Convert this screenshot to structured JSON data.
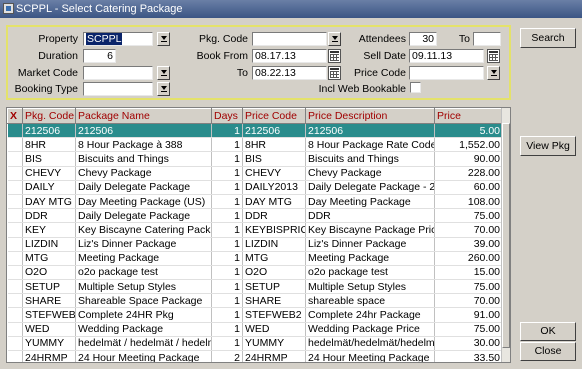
{
  "window": {
    "title": "SCPPL - Select Catering Package"
  },
  "filters": {
    "property_label": "Property",
    "property_value": "SCPPL",
    "duration_label": "Duration",
    "duration_value": "6",
    "market_code_label": "Market Code",
    "market_code_value": "",
    "booking_type_label": "Booking Type",
    "booking_type_value": "",
    "pkg_code_label": "Pkg. Code",
    "pkg_code_value": "",
    "book_from_label": "Book From",
    "book_from_value": "08.17.13",
    "to_label": "To",
    "book_to_value": "08.22.13",
    "attendees_label": "Attendees",
    "attendees_value": "30",
    "attendees_to_label": "To",
    "attendees_to_value": "",
    "sell_date_label": "Sell Date",
    "sell_date_value": "09.11.13",
    "price_code_label": "Price Code",
    "price_code_value": "",
    "incl_web_label": "Incl Web Bookable"
  },
  "buttons": {
    "search": "Search",
    "view_pkg": "View Pkg",
    "ok": "OK",
    "close": "Close"
  },
  "table": {
    "headers": {
      "x": "X",
      "pkg_code": "Pkg. Code",
      "package_name": "Package Name",
      "days": "Days",
      "price_code": "Price Code",
      "price_description": "Price Description",
      "price": "Price"
    },
    "rows": [
      {
        "code": "212506",
        "name": "212506",
        "days": "1",
        "pcode": "212506",
        "pdesc": "212506",
        "price": "5.00"
      },
      {
        "code": "8HR",
        "name": "8 Hour Package à 388",
        "days": "1",
        "pcode": "8HR",
        "pdesc": "8 Hour Package Rate Code",
        "price": "1,552.00"
      },
      {
        "code": "BIS",
        "name": "Biscuits and Things",
        "days": "1",
        "pcode": "BIS",
        "pdesc": "Biscuits and Things",
        "price": "90.00"
      },
      {
        "code": "CHEVY",
        "name": "Chevy Package",
        "days": "1",
        "pcode": "CHEVY",
        "pdesc": "Chevy Package",
        "price": "228.00"
      },
      {
        "code": "DAILY",
        "name": "Daily Delegate Package",
        "days": "1",
        "pcode": "DAILY2013",
        "pdesc": "Daily Delegate Package - 2013",
        "price": "60.00"
      },
      {
        "code": "DAY MTG",
        "name": "Day Meeting Package (US)",
        "days": "1",
        "pcode": "DAY MTG",
        "pdesc": "Day Meeting Package",
        "price": "108.00"
      },
      {
        "code": "DDR",
        "name": "Daily Delegate Package",
        "days": "1",
        "pcode": "DDR",
        "pdesc": "DDR",
        "price": "75.00"
      },
      {
        "code": "KEY",
        "name": "Key Biscayne Catering Package",
        "days": "1",
        "pcode": "KEYBISPRICE",
        "pdesc": "Key Biscayne Package Price",
        "price": "70.00"
      },
      {
        "code": "LIZDIN",
        "name": "Liz's Dinner Package",
        "days": "1",
        "pcode": "LIZDIN",
        "pdesc": "Liz's Dinner Package",
        "price": "39.00"
      },
      {
        "code": "MTG",
        "name": "Meeting Package",
        "days": "1",
        "pcode": "MTG",
        "pdesc": "Meeting Package",
        "price": "260.00"
      },
      {
        "code": "O2O",
        "name": "o2o package test",
        "days": "1",
        "pcode": "O2O",
        "pdesc": "o2o package test",
        "price": "15.00"
      },
      {
        "code": "SETUP",
        "name": "Multiple Setup Styles",
        "days": "1",
        "pcode": "SETUP",
        "pdesc": "Multiple Setup Styles",
        "price": "75.00"
      },
      {
        "code": "SHARE",
        "name": "Shareable Space Package",
        "days": "1",
        "pcode": "SHARE",
        "pdesc": "shareable space",
        "price": "70.00"
      },
      {
        "code": "STEFWEB2",
        "name": "Complete 24HR Pkg",
        "days": "1",
        "pcode": "STEFWEB2",
        "pdesc": "Complete 24hr Package",
        "price": "91.00"
      },
      {
        "code": "WED",
        "name": "Wedding Package",
        "days": "1",
        "pcode": "WED",
        "pdesc": "Wedding Package Price",
        "price": "75.00"
      },
      {
        "code": "YUMMY",
        "name": "hedelmät / hedelmät / hedelmät /",
        "days": "1",
        "pcode": "YUMMY",
        "pdesc": "hedelmät/hedelmät/hedelmät/",
        "price": "30.00"
      },
      {
        "code": "24HRMP",
        "name": "24 Hour Meeting Package",
        "days": "2",
        "pcode": "24HRMP",
        "pdesc": "24 Hour Meeting Package",
        "price": "33.50"
      }
    ]
  }
}
